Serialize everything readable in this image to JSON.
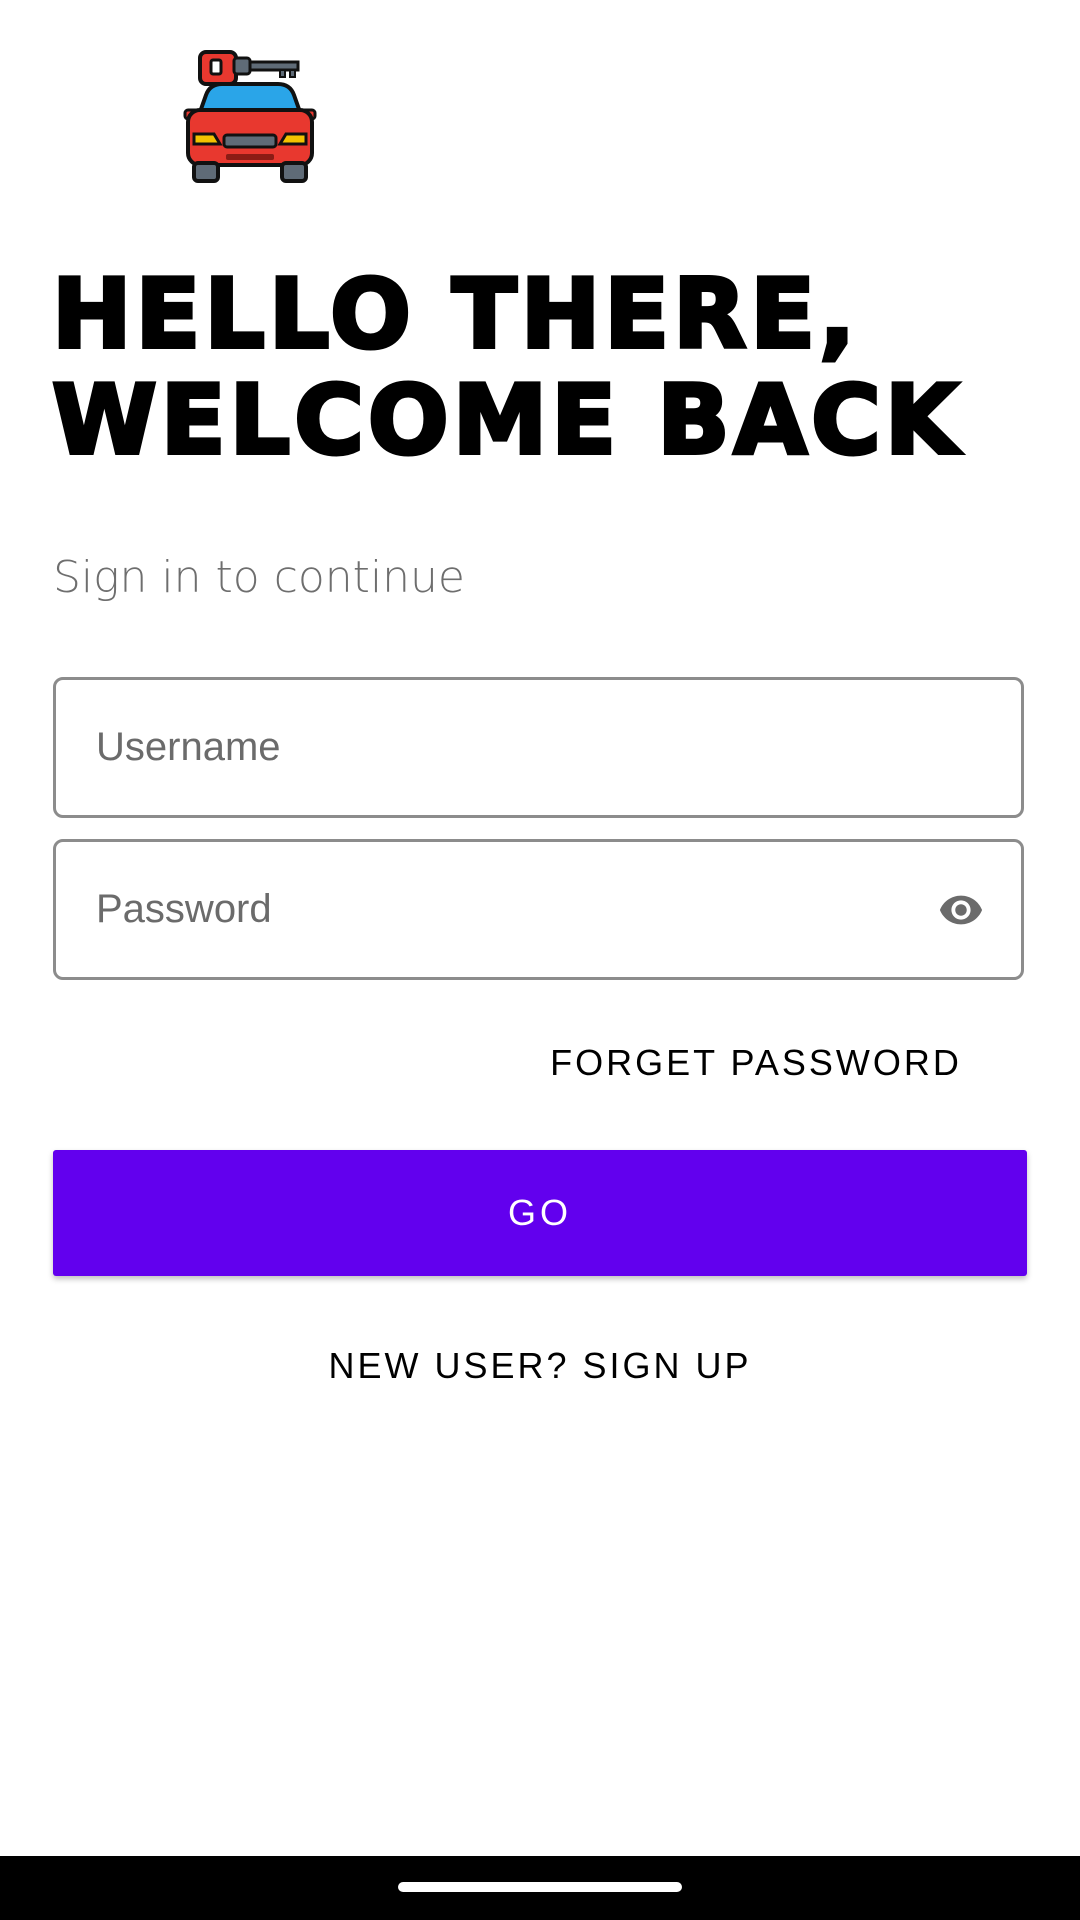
{
  "logo": {
    "icon": "car-key-icon"
  },
  "heading": {
    "line1": "HELLO THERE,",
    "line2": "WELCOME BACK"
  },
  "subtitle": "Sign in to continue",
  "form": {
    "username_placeholder": "Username",
    "password_placeholder": "Password",
    "password_toggle_icon": "eye-icon"
  },
  "forget_password_label": "FORGET PASSWORD",
  "go_button": {
    "label": "GO",
    "color": "#6200ee"
  },
  "signup_label": "NEW USER? SIGN UP"
}
